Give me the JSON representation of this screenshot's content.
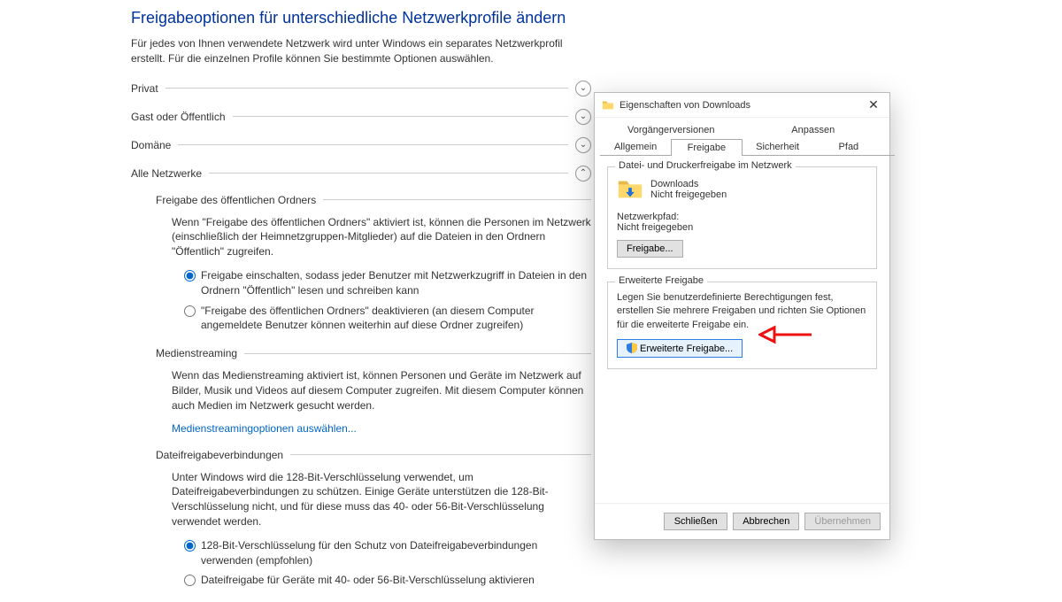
{
  "settings": {
    "title": "Freigabeoptionen für unterschiedliche Netzwerkprofile ändern",
    "intro": "Für jedes von Ihnen verwendete Netzwerk wird unter Windows ein separates Netzwerkprofil erstellt. Für die einzelnen Profile können Sie bestimmte Optionen auswählen.",
    "profiles": {
      "privat": "Privat",
      "gast": "Gast oder Öffentlich",
      "domaene": "Domäne",
      "alle": "Alle Netzwerke"
    },
    "public_folder": {
      "title": "Freigabe des öffentlichen Ordners",
      "desc": "Wenn \"Freigabe des öffentlichen Ordners\" aktiviert ist, können die Personen im Netzwerk (einschließlich der Heimnetzgruppen-Mitglieder) auf die Dateien in den Ordnern \"Öffentlich\" zugreifen.",
      "opt1": "Freigabe einschalten, sodass jeder Benutzer mit Netzwerkzugriff in Dateien in den Ordnern \"Öffentlich\" lesen und schreiben kann",
      "opt2": "\"Freigabe des öffentlichen Ordners\" deaktivieren (an diesem Computer angemeldete Benutzer können weiterhin auf diese Ordner zugreifen)"
    },
    "media": {
      "title": "Medienstreaming",
      "desc": "Wenn das Medienstreaming aktiviert ist, können Personen und Geräte im Netzwerk auf Bilder, Musik und Videos auf diesem Computer zugreifen. Mit diesem Computer können auch Medien im Netzwerk gesucht werden.",
      "link": "Medienstreamingoptionen auswählen..."
    },
    "encryption": {
      "title": "Dateifreigabeverbindungen",
      "desc": "Unter Windows wird die 128-Bit-Verschlüsselung verwendet, um Dateifreigabeverbindungen zu schützen. Einige Geräte unterstützen die 128-Bit-Verschlüsselung nicht, und für diese muss das 40- oder 56-Bit-Verschlüsselung verwendet werden.",
      "opt1": "128-Bit-Verschlüsselung für den Schutz von Dateifreigabeverbindungen verwenden (empfohlen)",
      "opt2": "Dateifreigabe für Geräte mit 40- oder 56-Bit-Verschlüsselung aktivieren"
    }
  },
  "dialog": {
    "title": "Eigenschaften von Downloads",
    "tabs": {
      "vorgaenger": "Vorgängerversionen",
      "anpassen": "Anpassen",
      "allgemein": "Allgemein",
      "freigabe": "Freigabe",
      "sicherheit": "Sicherheit",
      "pfad": "Pfad"
    },
    "network": {
      "group_title": "Datei- und Druckerfreigabe im Netzwerk",
      "folder_name": "Downloads",
      "folder_status": "Nicht freigegeben",
      "path_label": "Netzwerkpfad:",
      "path_value": "Nicht freigegeben",
      "share_btn": "Freigabe..."
    },
    "advanced": {
      "group_title": "Erweiterte Freigabe",
      "desc": "Legen Sie benutzerdefinierte Berechtigungen fest, erstellen Sie mehrere Freigaben und richten Sie Optionen für die erweiterte Freigabe ein.",
      "btn": "Erweiterte Freigabe..."
    },
    "footer": {
      "close": "Schließen",
      "cancel": "Abbrechen",
      "apply": "Übernehmen"
    }
  }
}
